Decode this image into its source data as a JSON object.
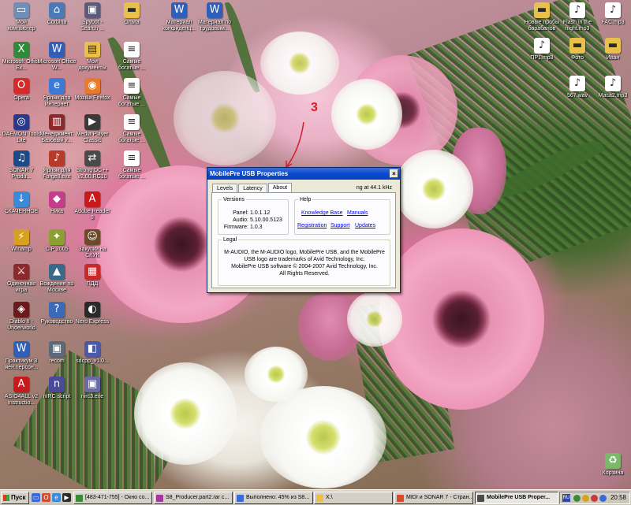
{
  "desktop": {
    "icons": [
      {
        "label": "Мой компьютер",
        "icon": "my-computer-icon",
        "color": "#6f8fb8",
        "glyph": "▭"
      },
      {
        "label": "Corbina",
        "icon": "network-icon",
        "color": "#4a7ab8",
        "glyph": "⌂"
      },
      {
        "label": "Spybot - Search ...",
        "icon": "spybot-icon",
        "color": "#5a5a7a",
        "glyph": "▣"
      },
      {
        "label": "Ольга",
        "icon": "folder-icon",
        "color": "#e8c04a",
        "glyph": "▬"
      },
      {
        "label": "Материал конфиденц...",
        "icon": "word-doc-icon",
        "color": "#2f5fb8",
        "glyph": "W"
      },
      {
        "label": "Материал по трудовым...",
        "icon": "word-doc-icon",
        "color": "#2f5fb8",
        "glyph": "W"
      },
      {
        "label": "Microsoft Office Ex...",
        "icon": "excel-icon",
        "color": "#2f8a3a",
        "glyph": "X"
      },
      {
        "label": "Microsoft Office W...",
        "icon": "word-icon",
        "color": "#2f5fb8",
        "glyph": "W"
      },
      {
        "label": "Мои документы",
        "icon": "my-documents-icon",
        "color": "#e8c04a",
        "glyph": "▤"
      },
      {
        "label": "Самые богатые ...",
        "icon": "document-icon",
        "color": "#ffffff",
        "glyph": "≡"
      },
      {
        "label": "Opera",
        "icon": "opera-icon",
        "color": "#d42a2a",
        "glyph": "O"
      },
      {
        "label": "Ярлык для Интернет",
        "icon": "internet-icon",
        "color": "#3a7ad8",
        "glyph": "e"
      },
      {
        "label": "Mozilla Firefox",
        "icon": "firefox-icon",
        "color": "#e87a2a",
        "glyph": "◉"
      },
      {
        "label": "Самые богатые ...",
        "icon": "document-icon",
        "color": "#ffffff",
        "glyph": "≡"
      },
      {
        "label": "DAEMON Tools Lite",
        "icon": "daemon-tools-icon",
        "color": "#2a3a8a",
        "glyph": "◎"
      },
      {
        "label": "Менеджмент. Базовый к...",
        "icon": "book-icon",
        "color": "#8a2a2a",
        "glyph": "▥"
      },
      {
        "label": "Media Player Classic",
        "icon": "media-player-icon",
        "color": "#3a3a3a",
        "glyph": "▶"
      },
      {
        "label": "Самые богатые ...",
        "icon": "document-icon",
        "color": "#ffffff",
        "glyph": "≡"
      },
      {
        "label": "SONAR 7 Produ...",
        "icon": "sonar-icon",
        "color": "#1a4a8a",
        "glyph": "♫"
      },
      {
        "label": "Ярлык для Forge8.exe",
        "icon": "forge-icon",
        "color": "#b83a2a",
        "glyph": "♪"
      },
      {
        "label": "Strong DC++ v2.00.RC10",
        "icon": "strongdc-icon",
        "color": "#4a4a4a",
        "glyph": "⇄"
      },
      {
        "label": "Самые богатые ...",
        "icon": "document-icon",
        "color": "#ffffff",
        "glyph": "≡"
      },
      {
        "label": "СКАЧЕННОЕ",
        "icon": "downloads-icon",
        "color": "#3a8ad8",
        "glyph": "↓"
      },
      {
        "label": "Ника",
        "icon": "nika-icon",
        "color": "#c83a8a",
        "glyph": "◆"
      },
      {
        "label": "Adobe Reader 8",
        "icon": "adobe-reader-icon",
        "color": "#c81a1a",
        "glyph": "A"
      },
      {
        "label": "Winamp",
        "icon": "winamp-icon",
        "color": "#d8a020",
        "glyph": "⚡"
      },
      {
        "label": "CIP 2005",
        "icon": "cip-icon",
        "color": "#8aa030",
        "glyph": "✦"
      },
      {
        "label": "Закупки на СКУК",
        "icon": "contacts-icon",
        "color": "#6a4a2a",
        "glyph": "☺"
      },
      {
        "label": "Одиночная игра",
        "icon": "game-icon",
        "color": "#8a2a2a",
        "glyph": "⚔"
      },
      {
        "label": "Вождение по Москве",
        "icon": "driving-icon",
        "color": "#3a6a8a",
        "glyph": "▲"
      },
      {
        "label": "ПДД",
        "icon": "pdd-icon",
        "color": "#c82a2a",
        "glyph": "▦"
      },
      {
        "label": "Diablo II - Underworld",
        "icon": "diablo-icon",
        "color": "#6a1a1a",
        "glyph": "◈"
      },
      {
        "label": "Руководство",
        "icon": "guide-icon",
        "color": "#3a6ab8",
        "glyph": "?"
      },
      {
        "label": "Nero Express",
        "icon": "nero-icon",
        "color": "#2a2a2a",
        "glyph": "◐"
      },
      {
        "label": "Практикум 3 мен.персон...",
        "icon": "word-doc-icon",
        "color": "#2f5fb8",
        "glyph": "W"
      },
      {
        "label": "recom",
        "icon": "recom-icon",
        "color": "#5a6a7a",
        "glyph": "▣"
      },
      {
        "label": "sdcpp_v1.0...",
        "icon": "sdcpp-icon",
        "color": "#4a5aa8",
        "glyph": "◧"
      },
      {
        "label": "ASIO4ALL v2 Instructio...",
        "icon": "pdf-icon",
        "color": "#c81a1a",
        "glyph": "A"
      },
      {
        "label": "nIRC script",
        "icon": "nirc-icon",
        "color": "#4a4a9a",
        "glyph": "n"
      },
      {
        "label": "nirc3.exe",
        "icon": "exe-icon",
        "color": "#6a6aa8",
        "glyph": "▣"
      },
      {
        "label": "Новые пробы барабанов",
        "icon": "folder-icon",
        "color": "#e8c04a",
        "glyph": "▬"
      },
      {
        "label": "Flash in the night.mp3",
        "icon": "mp3-icon",
        "color": "#ffffff",
        "glyph": "♪"
      },
      {
        "label": "FAC.mp3",
        "icon": "mp3-icon",
        "color": "#ffffff",
        "glyph": "♪"
      },
      {
        "label": "ПР1.mp3",
        "icon": "mp3-icon",
        "color": "#ffffff",
        "glyph": "♪"
      },
      {
        "label": "Фото",
        "icon": "folder-icon",
        "color": "#e8c04a",
        "glyph": "▬"
      },
      {
        "label": "Иван",
        "icon": "folder-icon",
        "color": "#e8c04a",
        "glyph": "▬"
      },
      {
        "label": "567.wav",
        "icon": "wav-icon",
        "color": "#ffffff",
        "glyph": "♪"
      },
      {
        "label": "Маса2.mp3",
        "icon": "mp3-icon",
        "color": "#ffffff",
        "glyph": "♪"
      },
      {
        "label": "Корзина",
        "icon": "recycle-bin-icon",
        "color": "#7ab86a",
        "glyph": "♻"
      }
    ]
  },
  "annotation": {
    "text": "3"
  },
  "dialog": {
    "title": "MobilePre USB Properties",
    "close_label": "×",
    "tabs": [
      {
        "label": "Levels"
      },
      {
        "label": "Latency"
      },
      {
        "label": "About"
      }
    ],
    "status_text": "ng at 44.1 kHz",
    "versions": {
      "legend": "Versions",
      "rows": [
        {
          "key": "Panel:",
          "value": "1.0.1.12"
        },
        {
          "key": "Audio:",
          "value": "5.10.00.5123"
        },
        {
          "key": "Firmware:",
          "value": "1.0.3"
        }
      ]
    },
    "help": {
      "legend": "Help",
      "links": [
        {
          "label": "Knowledge Base"
        },
        {
          "label": "Manuals"
        },
        {
          "label": "Registration"
        },
        {
          "label": "Support"
        },
        {
          "label": "Updates"
        }
      ]
    },
    "legal": {
      "legend": "Legal",
      "lines": [
        "M-AUDIO, the M-AUDIO logo, MobilePre USB, and the MobilePre",
        "USB logo are trademarks of Avid Technology, Inc.",
        "MobilePre USB software © 2004-2007 Avid Technology, Inc.",
        "All Rights Reserved."
      ]
    }
  },
  "taskbar": {
    "start_label": "Пуск",
    "tasks": [
      {
        "label": "[483-471-755] - Окно со...",
        "color": "#3a8a3a"
      },
      {
        "label": "S8_Producer.part2.rar c...",
        "color": "#a03aa0"
      },
      {
        "label": "Выполнено: 45% из S8...",
        "color": "#3a6ad8"
      },
      {
        "label": "X:\\",
        "color": "#e8c04a"
      },
      {
        "label": "MIDI и SONAR 7 - Стран...",
        "color": "#d84a2a"
      },
      {
        "label": "MobilePre USB Proper...",
        "color": "#4a4a4a"
      }
    ],
    "lang": "RU",
    "clock": "20:58"
  }
}
